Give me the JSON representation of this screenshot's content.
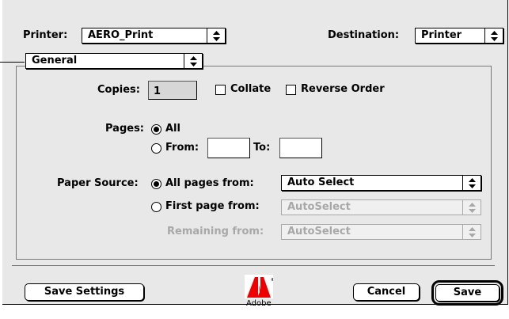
{
  "header": {
    "printer_label": "Printer:",
    "printer_value": "AERO_Print",
    "destination_label": "Destination:",
    "destination_value": "Printer"
  },
  "panel_popup": {
    "value": "General"
  },
  "copies": {
    "label": "Copies:",
    "value": "1"
  },
  "collate": {
    "label": "Collate",
    "checked": false
  },
  "reverse_order": {
    "label": "Reverse Order",
    "checked": false
  },
  "pages": {
    "label": "Pages:",
    "all_label": "All",
    "from_label": "From:",
    "to_label": "To:",
    "from_value": "",
    "to_value": "",
    "selected": "All"
  },
  "paper_source": {
    "label": "Paper Source:",
    "all_pages_label": "All pages from:",
    "all_pages_value": "Auto Select",
    "first_page_label": "First page from:",
    "first_page_value": "AutoSelect",
    "remaining_label": "Remaining from:",
    "remaining_value": "AutoSelect",
    "selected": "All pages from:"
  },
  "footer": {
    "save_settings_label": "Save Settings",
    "logo_text": "Adobe",
    "cancel_label": "Cancel",
    "save_label": "Save"
  },
  "icons": {
    "popup_arrow": "updown-arrows-icon",
    "logo": "adobe-logo-icon"
  }
}
